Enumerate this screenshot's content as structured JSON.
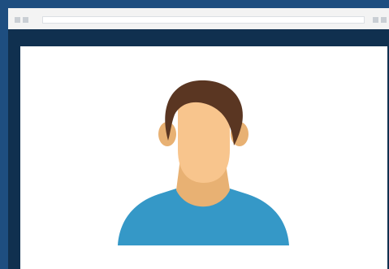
{
  "window": {
    "title": ""
  },
  "address_bar": {
    "value": ""
  },
  "content": {
    "image": "user-avatar-icon"
  },
  "colors": {
    "background": "#1e4e80",
    "window_frame": "#10304f",
    "titlebar": "#f3f3f3",
    "page": "#ffffff",
    "hair": "#5a3622",
    "skin": "#f8c58d",
    "skin_shadow": "#e8b173",
    "shirt": "#3598c7"
  }
}
